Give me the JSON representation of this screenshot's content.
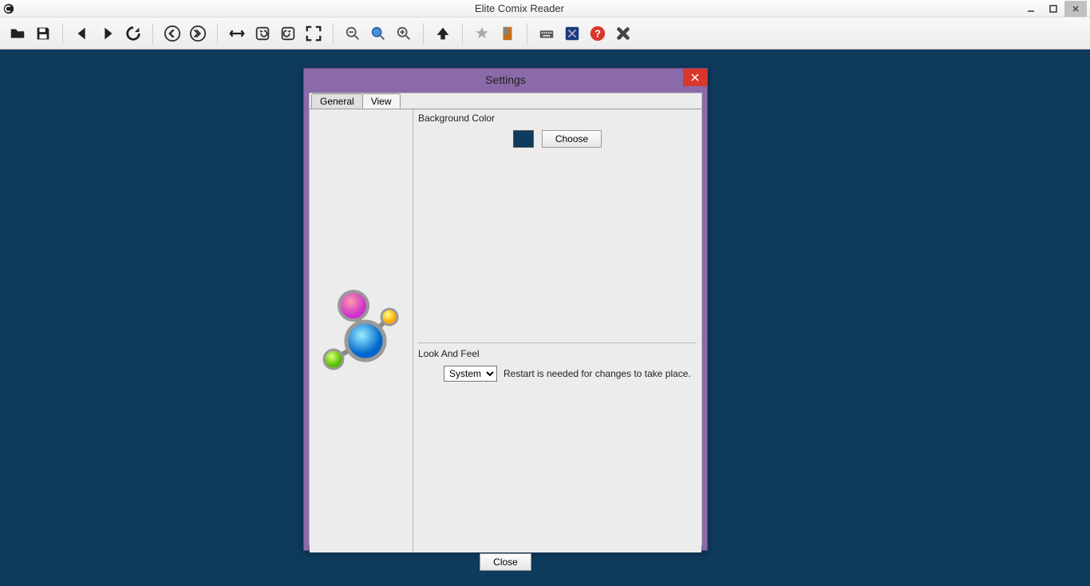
{
  "app": {
    "title": "Elite Comix Reader"
  },
  "toolbar": {
    "open": "open",
    "save": "save",
    "prev": "prev",
    "next": "next",
    "reload": "reload",
    "first": "first",
    "last": "last",
    "fitwidth": "fitwidth",
    "rotleft": "rotleft",
    "rotright": "rotright",
    "fullscreen": "fullscreen",
    "zoomout": "zoomout",
    "zoomfit": "zoomfit",
    "zoomin": "zoomin",
    "up": "up",
    "star": "star",
    "bookmark": "bookmark",
    "keyboard": "keyboard",
    "settings": "settings",
    "help": "help",
    "exit": "exit"
  },
  "dialog": {
    "title": "Settings",
    "tabs": {
      "general": "General",
      "view": "View"
    },
    "bg": {
      "label": "Background Color",
      "choose": "Choose",
      "color": "#0e3a5c"
    },
    "look": {
      "label": "Look And Feel",
      "selected": "System",
      "restart": "Restart is needed for changes to take place."
    },
    "close": "Close"
  }
}
